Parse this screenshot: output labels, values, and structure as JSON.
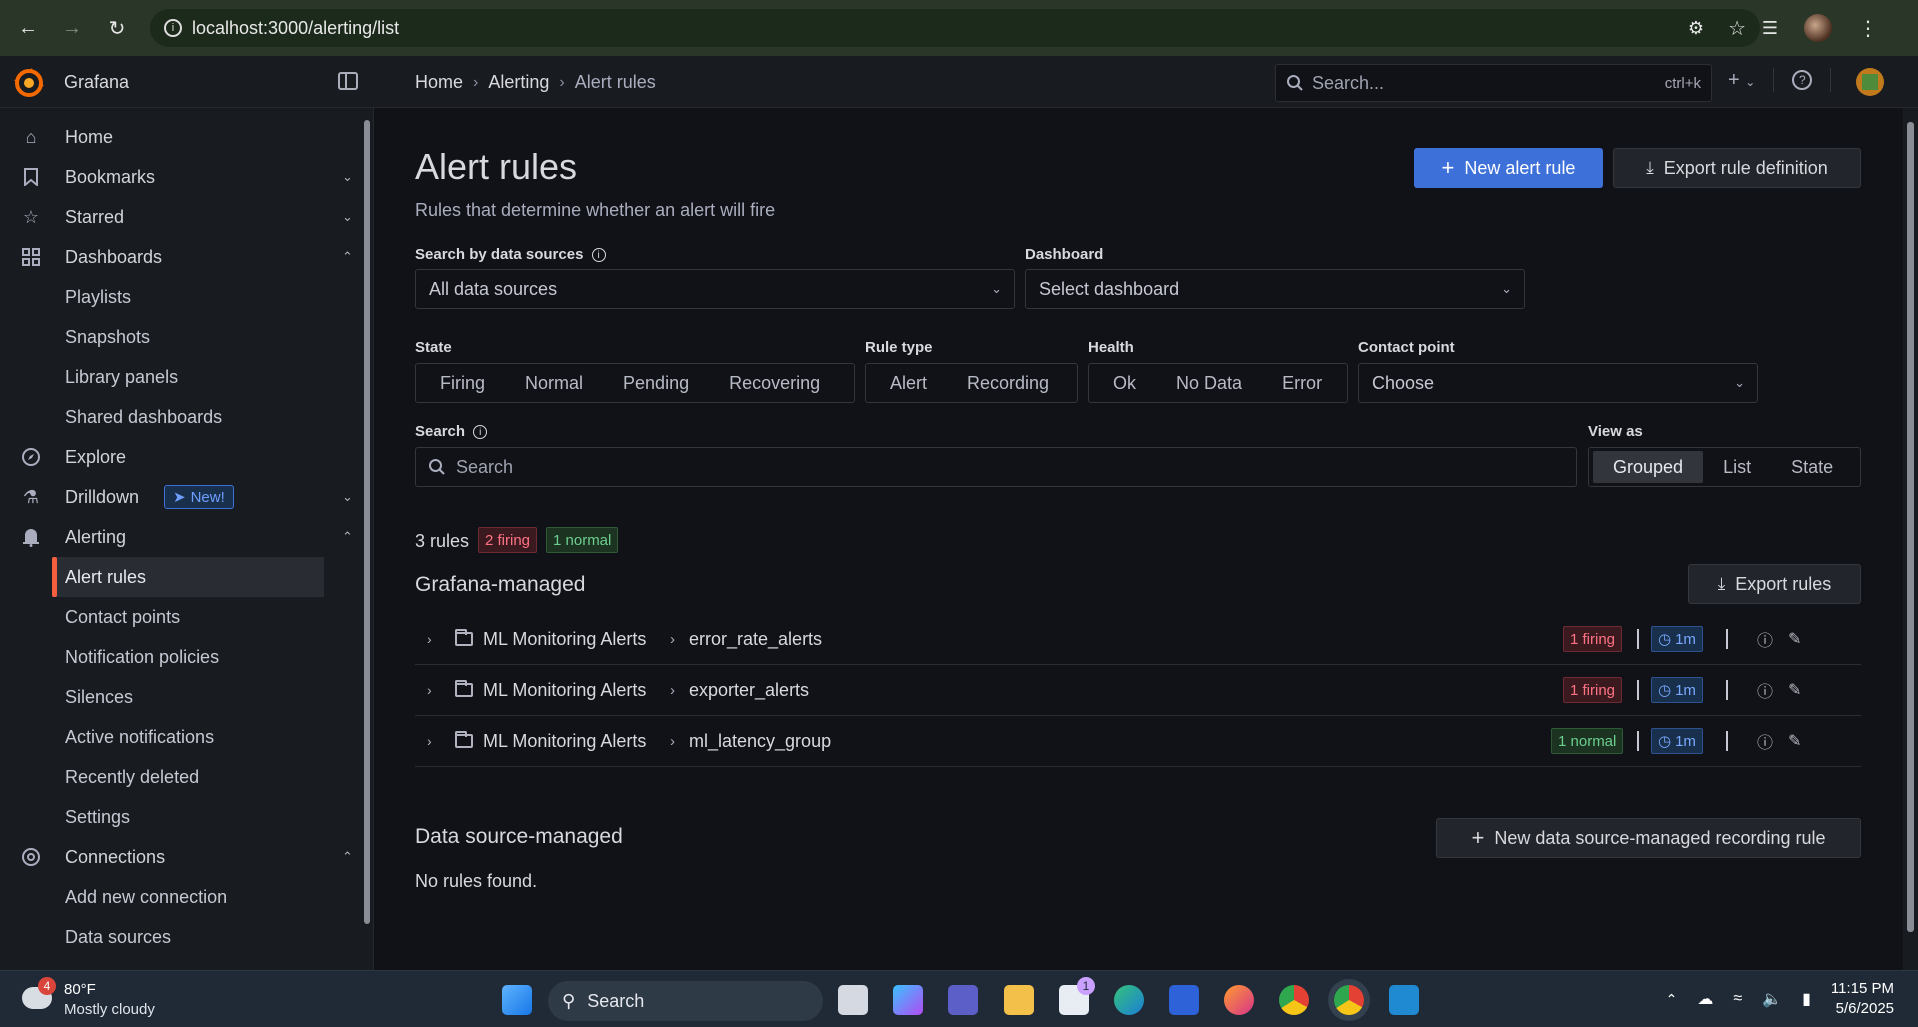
{
  "browser": {
    "url": "localhost:3000/alerting/list"
  },
  "app": {
    "brand": "Grafana",
    "breadcrumbs": [
      "Home",
      "Alerting",
      "Alert rules"
    ],
    "search_placeholder": "Search...",
    "search_shortcut": "ctrl+k"
  },
  "sidebar": {
    "items": [
      {
        "label": "Home",
        "icon": "home-icon"
      },
      {
        "label": "Bookmarks",
        "icon": "bookmark-icon"
      },
      {
        "label": "Starred",
        "icon": "star-icon"
      },
      {
        "label": "Dashboards",
        "icon": "dashboards-icon"
      },
      {
        "label": "Playlists"
      },
      {
        "label": "Snapshots"
      },
      {
        "label": "Library panels"
      },
      {
        "label": "Shared dashboards"
      },
      {
        "label": "Explore",
        "icon": "compass-icon"
      },
      {
        "label": "Drilldown",
        "icon": "drilldown-icon",
        "badge": "New!"
      },
      {
        "label": "Alerting",
        "icon": "bell-icon"
      },
      {
        "label": "Alert rules"
      },
      {
        "label": "Contact points"
      },
      {
        "label": "Notification policies"
      },
      {
        "label": "Silences"
      },
      {
        "label": "Active notifications"
      },
      {
        "label": "Recently deleted"
      },
      {
        "label": "Settings"
      },
      {
        "label": "Connections",
        "icon": "connections-icon"
      },
      {
        "label": "Add new connection"
      },
      {
        "label": "Data sources"
      }
    ]
  },
  "page": {
    "title": "Alert rules",
    "subtitle": "Rules that determine whether an alert will fire",
    "new_rule_label": "New alert rule",
    "export_def_label": "Export rule definition"
  },
  "filters": {
    "datasource_label": "Search by data sources",
    "datasource_value": "All data sources",
    "dashboard_label": "Dashboard",
    "dashboard_placeholder": "Select dashboard",
    "state_label": "State",
    "state_options": [
      "Firing",
      "Normal",
      "Pending",
      "Recovering"
    ],
    "ruletype_label": "Rule type",
    "ruletype_options": [
      "Alert",
      "Recording"
    ],
    "health_label": "Health",
    "health_options": [
      "Ok",
      "No Data",
      "Error"
    ],
    "contact_label": "Contact point",
    "contact_placeholder": "Choose",
    "search_label": "Search",
    "search_placeholder": "Search",
    "viewas_label": "View as",
    "viewas_options": [
      "Grouped",
      "List",
      "State"
    ],
    "viewas_selected": "Grouped"
  },
  "summary": {
    "count": "3 rules",
    "firing": "2 firing",
    "normal": "1 normal"
  },
  "grafana_managed": {
    "title": "Grafana-managed",
    "export_label": "Export rules",
    "groups": [
      {
        "namespace": "ML Monitoring Alerts",
        "group": "error_rate_alerts",
        "status": "1 firing",
        "status_kind": "firing",
        "interval": "1m"
      },
      {
        "namespace": "ML Monitoring Alerts",
        "group": "exporter_alerts",
        "status": "1 firing",
        "status_kind": "firing",
        "interval": "1m"
      },
      {
        "namespace": "ML Monitoring Alerts",
        "group": "ml_latency_group",
        "status": "1 normal",
        "status_kind": "normal",
        "interval": "1m"
      }
    ]
  },
  "datasource_managed": {
    "title": "Data source-managed",
    "new_label": "New data source-managed recording rule",
    "empty": "No rules found."
  },
  "taskbar": {
    "weather_badge": "4",
    "temp": "80°F",
    "condition": "Mostly cloudy",
    "search": "Search",
    "store_badge": "1",
    "time": "11:15 PM",
    "date": "5/6/2025"
  },
  "colors": {
    "accent": "#3d71d9",
    "firing": "#ff7383",
    "normal": "#6ccf8e",
    "active_indicator": "#f55f3e"
  }
}
